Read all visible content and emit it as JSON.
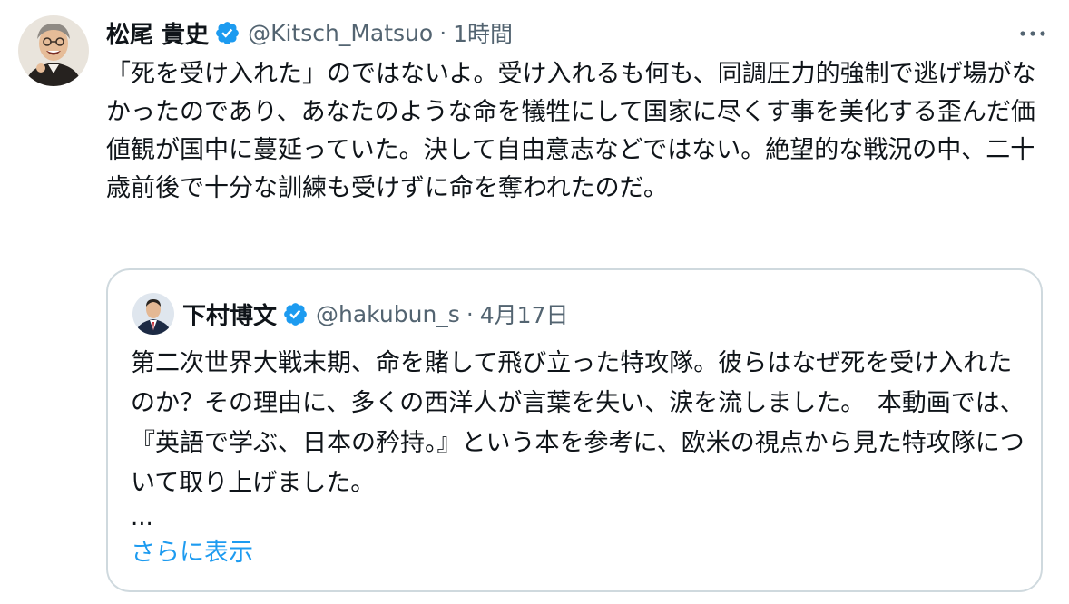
{
  "tweet": {
    "author_name": "松尾 貴史",
    "handle": "@Kitsch_Matsuo",
    "separator": "·",
    "time": "1時間",
    "text": "「死を受け入れた」のではないよ。受け入れるも何も、同調圧力的強制で逃げ場がなかったのであり、あなたのような命を犠牲にして国家に尽くす事を美化する歪んだ価値観が国中に蔓延っていた。決して自由意志などではない。絶望的な戦況の中、二十歳前後で十分な訓練も受けずに命を奪われたのだ。"
  },
  "quoted": {
    "author_name": "下村博文",
    "handle": "@hakubun_s",
    "separator": "·",
    "date": "4月17日",
    "text": "第二次世界大戦末期、命を賭して飛び立った特攻隊。彼らはなぜ死を受け入れたのか？その理由に、多くの西洋人が言葉を失い、涙を流しました。　本動画では、『英語で学ぶ、日本の矜持。』という本を参考に、欧米の視点から見た特攻隊について取り上げました。",
    "ellipsis": "...",
    "show_more": "さらに表示"
  },
  "colors": {
    "text": "#0f1419",
    "secondary": "#536471",
    "link": "#1d9bf0",
    "verified": "#1d9bf0",
    "border": "#cfd9de"
  },
  "icons": {
    "verified": "verified-badge-icon",
    "more": "more-options-icon"
  }
}
